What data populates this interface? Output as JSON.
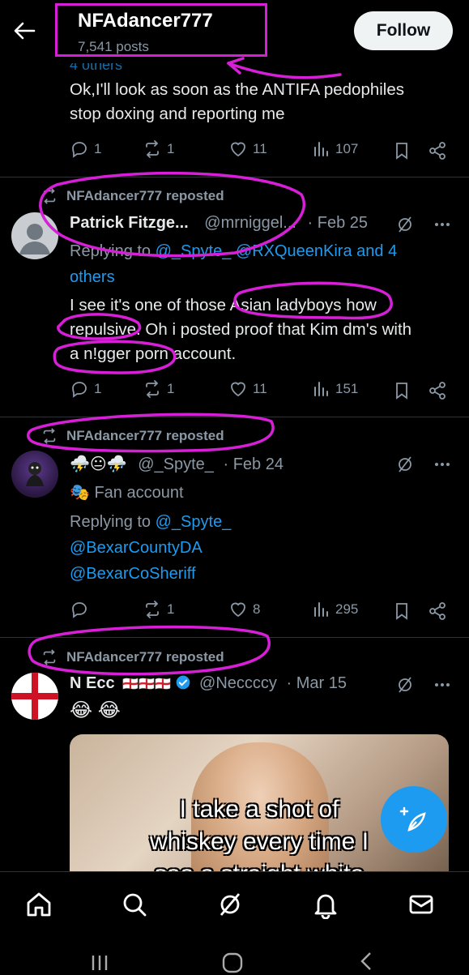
{
  "header": {
    "name": "NFAdancer777",
    "posts": "7,541 posts",
    "follow_label": "Follow"
  },
  "tweet0": {
    "ghost_text": "4 others",
    "text_l1": "Ok,I'll look as soon as the ANTIFA pedophiles",
    "text_l2": "stop doxing and reporting me",
    "replies": "1",
    "reposts": "1",
    "likes": "11",
    "views": "107"
  },
  "tweet1": {
    "repost_label": "NFAdancer777 reposted",
    "author_name": "Patrick Fitzge...",
    "author_handle": "@mrniggel...",
    "date": "· Feb 25",
    "reply_prefix": "Replying to",
    "reply_to_1": "@_Spyte_",
    "reply_to_2": "@RXQueenKira",
    "reply_and": "and 4",
    "reply_others": "others",
    "text_l1": "I see it's one of those Asian ladyboys how",
    "text_l2": "repulsive. Oh i posted proof that Kim dm's with",
    "text_l3": "a n!gger porn account.",
    "replies": "1",
    "reposts": "1",
    "likes": "11",
    "views": "151"
  },
  "tweet2": {
    "repost_label": "NFAdancer777 reposted",
    "author_name": "⛈️😐⛈️",
    "author_handle": "@_Spyte_",
    "date": "· Feb 24",
    "badge": "🎭 Fan account",
    "reply_prefix": "Replying to",
    "reply_to_1": "@_Spyte_",
    "reply_to_2": "@BexarCountyDA",
    "reply_to_3": "@BexarCoSheriff",
    "replies": "",
    "reposts": "1",
    "likes": "8",
    "views": "295"
  },
  "tweet3": {
    "repost_label": "NFAdancer777 reposted",
    "author_name": "N Ecc",
    "author_flags": "🏴󠁧󠁢󠁥󠁮󠁧󠁿🏴󠁧󠁢󠁥󠁮󠁧󠁿🏴󠁧󠁢󠁥󠁮󠁧󠁿",
    "author_handle": "@Neccccy",
    "date": "· Mar 15",
    "text": "😂 😂",
    "meme_l1": "I take a shot of",
    "meme_l2": "whiskey every time I",
    "meme_l3": "see a straight white"
  },
  "colors": {
    "annotation": "#d61fd6",
    "link": "#1d9bf0",
    "muted": "#8b98a5",
    "text": "#e7e9ea"
  }
}
